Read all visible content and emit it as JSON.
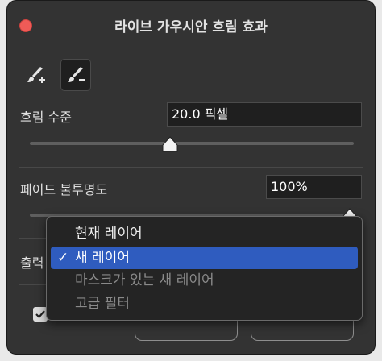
{
  "dialog": {
    "title": "라이브 가우시안 흐림 효과"
  },
  "tools": [
    {
      "name": "brush-add",
      "icon": "brush-plus-icon"
    },
    {
      "name": "brush-subtract",
      "icon": "brush-minus-icon",
      "active": true
    }
  ],
  "blur": {
    "label": "흐림 수준",
    "value": "20.0 픽셀"
  },
  "fade": {
    "label": "페이드 불투명도",
    "value": "100%"
  },
  "output": {
    "label": "출력",
    "options": [
      {
        "label": "현재 레이어",
        "selected": false,
        "disabled": false
      },
      {
        "label": "새 레이어",
        "selected": true,
        "disabled": false
      },
      {
        "label": "마스크가 있는 새 레이어",
        "selected": false,
        "disabled": true
      },
      {
        "label": "고급 필터",
        "selected": false,
        "disabled": true
      }
    ],
    "check_glyph": "✓"
  },
  "preview": {
    "checked": true
  },
  "colors": {
    "selection": "#2f5cbf",
    "close": "#ef5b57"
  }
}
